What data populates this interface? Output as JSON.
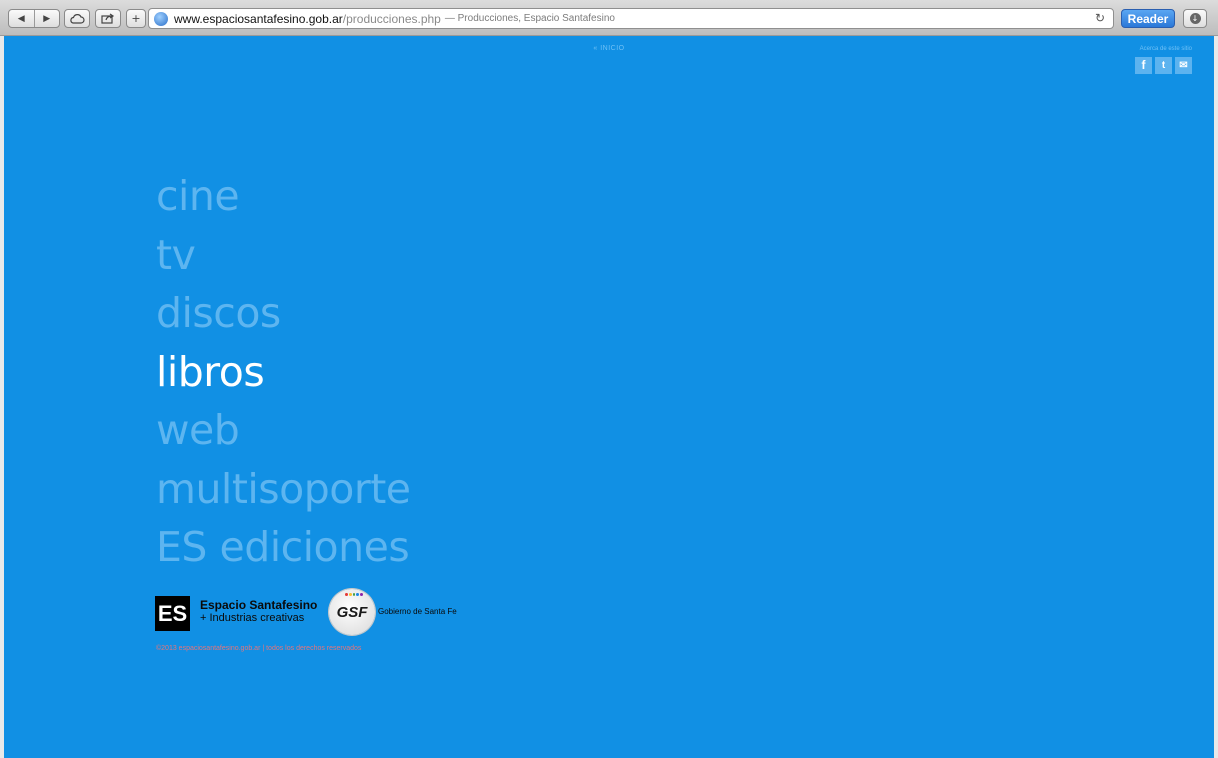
{
  "browser": {
    "nav_back": "◀",
    "nav_forward": "▶",
    "add_tab": "+",
    "url_domain": "www.espaciosantafesino.gob.ar",
    "url_path": "/producciones.php",
    "page_title": "— Producciones, Espacio Santafesino",
    "reload_icon": "reload-icon",
    "reader_label": "Reader"
  },
  "header": {
    "home_link": "« INICIO",
    "about_label": "Acerca de este sitio",
    "social": [
      {
        "icon": "facebook-icon",
        "glyph": "f"
      },
      {
        "icon": "twitter-icon",
        "glyph": "t"
      },
      {
        "icon": "mail-icon",
        "glyph": "✉"
      }
    ]
  },
  "menu": {
    "items": [
      {
        "label": "cine",
        "active": false
      },
      {
        "label": "tv",
        "active": false
      },
      {
        "label": "discos",
        "active": false
      },
      {
        "label": "libros",
        "active": true
      },
      {
        "label": "web",
        "active": false
      },
      {
        "label": "multisoporte",
        "active": false
      },
      {
        "label": "ES ediciones",
        "active": false
      }
    ]
  },
  "footer": {
    "es_logo_mark": "ES",
    "es_name": "Espacio Santafesino",
    "es_tagline": "+ Industrias creativas",
    "gsf_mark": "GSF",
    "gsf_name": "Gobierno de Santa Fe",
    "copyright": "©2013 espaciosantafesino.gob.ar | todos los derechos reservados"
  },
  "colors": {
    "page_background": "#1190e4",
    "menu_inactive": "#5db5f0",
    "menu_active": "#ffffff",
    "copyright": "#e5757b"
  }
}
